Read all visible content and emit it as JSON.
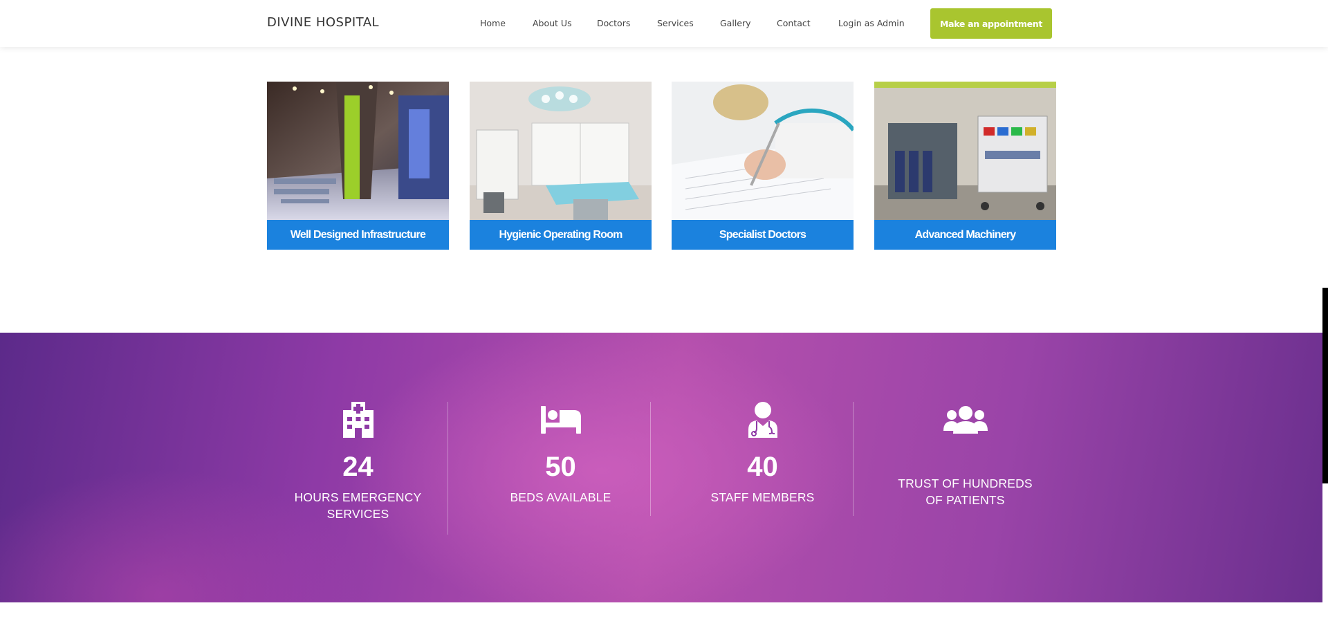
{
  "navbar": {
    "brand": "DIVINE HOSPITAL",
    "links": [
      {
        "label": "Home"
      },
      {
        "label": "About Us"
      },
      {
        "label": "Doctors"
      },
      {
        "label": "Services"
      },
      {
        "label": "Gallery"
      },
      {
        "label": "Contact"
      },
      {
        "label": "Login as Admin"
      }
    ],
    "cta_label": "Make an appointment"
  },
  "features": [
    {
      "label": "Well Designed Infrastructure"
    },
    {
      "label": "Hygienic Operating Room"
    },
    {
      "label": "Specialist Doctors"
    },
    {
      "label": "Advanced Machinery"
    }
  ],
  "stats": [
    {
      "icon": "hospital-icon",
      "number": "24",
      "caption": "HOURS EMERGENCY SERVICES"
    },
    {
      "icon": "bed-icon",
      "number": "50",
      "caption": "BEDS AVAILABLE"
    },
    {
      "icon": "user-doctor-icon",
      "number": "40",
      "caption": "STAFF MEMBERS"
    },
    {
      "icon": "users-icon",
      "number": "",
      "caption": "TRUST OF HUNDREDS OF PATIENTS"
    }
  ],
  "colors": {
    "accent_green": "#a9c52f",
    "card_blue": "#1b82de",
    "band_purple": "#8e3aa6"
  }
}
